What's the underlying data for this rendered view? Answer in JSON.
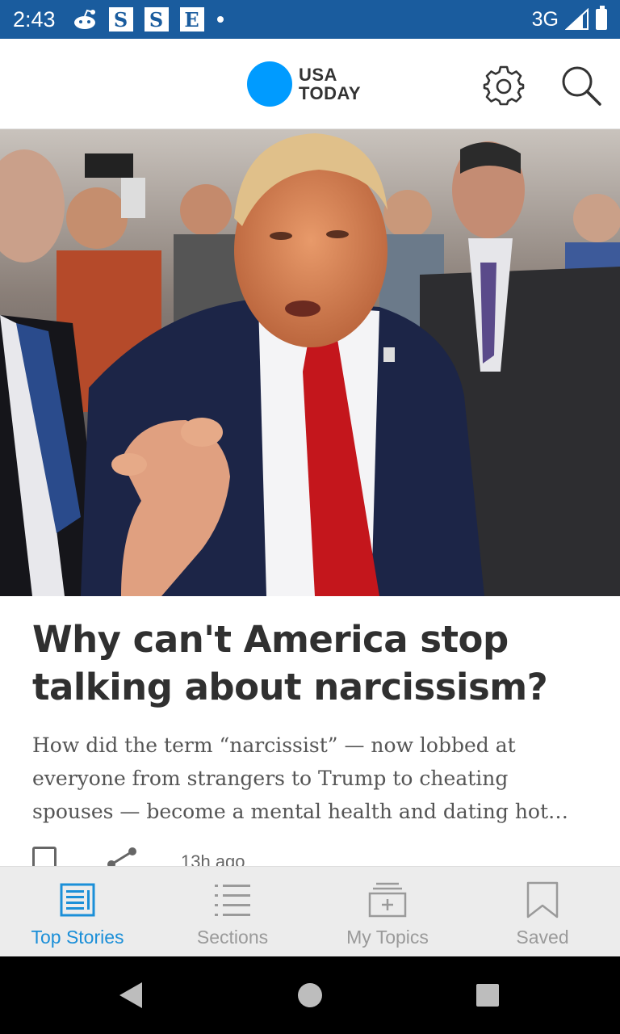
{
  "status_bar": {
    "time": "2:43",
    "notification_icons": [
      "reddit-icon",
      "S",
      "S",
      "E"
    ],
    "network": "3G"
  },
  "header": {
    "logo_line1": "USA",
    "logo_line2": "TODAY"
  },
  "article": {
    "headline": "Why can't America stop talking about narcissism?",
    "summary": "How did the term “narcissist” — now lobbed at everyone from strangers to Trump to cheating spouses — become a mental health and dating hot…",
    "age": "13h ago"
  },
  "bottom_nav": {
    "items": [
      {
        "label": "Top Stories",
        "icon": "newspaper-icon",
        "active": true
      },
      {
        "label": "Sections",
        "icon": "list-icon",
        "active": false
      },
      {
        "label": "My Topics",
        "icon": "add-folder-icon",
        "active": false
      },
      {
        "label": "Saved",
        "icon": "bookmark-icon",
        "active": false
      }
    ]
  },
  "colors": {
    "status_bar": "#1a5c9e",
    "brand_blue": "#009bff",
    "active_nav": "#1b8fd8",
    "inactive_nav": "#9a9a9a"
  }
}
